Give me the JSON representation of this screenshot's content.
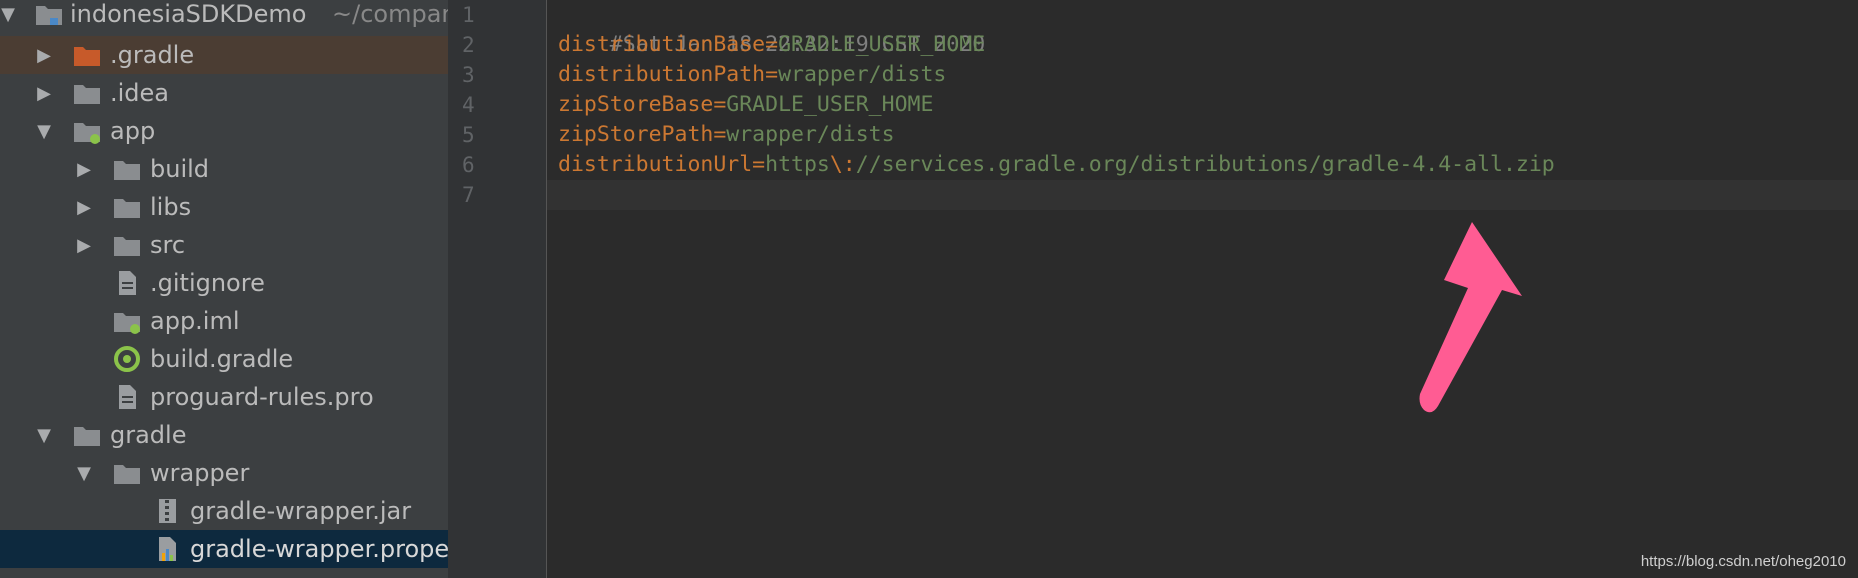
{
  "project_tree": {
    "root": {
      "name": "indonesiaSDKDemo",
      "path": "~/compan"
    },
    "items": [
      {
        "label": ".gradle"
      },
      {
        "label": ".idea"
      },
      {
        "label": "app"
      },
      {
        "label": "build"
      },
      {
        "label": "libs"
      },
      {
        "label": "src"
      },
      {
        "label": ".gitignore"
      },
      {
        "label": "app.iml"
      },
      {
        "label": "build.gradle"
      },
      {
        "label": "proguard-rules.pro"
      },
      {
        "label": "gradle"
      },
      {
        "label": "wrapper"
      },
      {
        "label": "gradle-wrapper.jar"
      },
      {
        "label": "gradle-wrapper.prope"
      }
    ]
  },
  "editor": {
    "line_numbers": [
      "1",
      "2",
      "3",
      "4",
      "5",
      "6",
      "7"
    ],
    "lines": [
      {
        "comment": "#Sat Jan 18 22:32:19 CST 2020"
      },
      {
        "key": "distributionBase",
        "eq": "=",
        "value": "GRADLE_USER_HOME"
      },
      {
        "key": "distributionPath",
        "eq": "=",
        "value": "wrapper/dists"
      },
      {
        "key": "zipStoreBase",
        "eq": "=",
        "value": "GRADLE_USER_HOME"
      },
      {
        "key": "zipStorePath",
        "eq": "=",
        "value": "wrapper/dists"
      },
      {
        "key": "distributionUrl",
        "eq": "=",
        "value_a": "https",
        "esc": "\\:",
        "value_b": "//services.gradle.org/distributions/gradle-4.4-all.zip"
      }
    ]
  },
  "watermark": "https://blog.csdn.net/oheg2010",
  "colors": {
    "key": "#cc7832",
    "value": "#6a8759",
    "comment": "#808080",
    "arrow_annotation": "#ff5c93"
  }
}
